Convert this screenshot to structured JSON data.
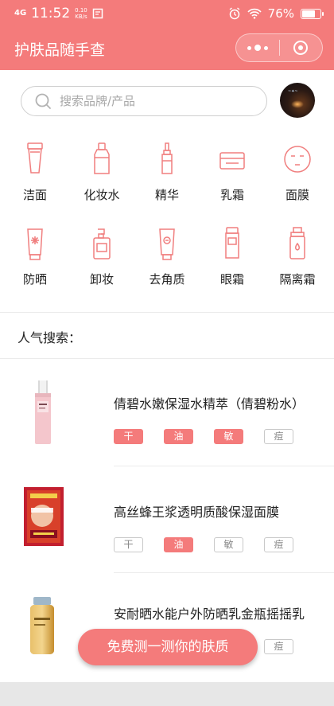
{
  "status_bar": {
    "signal": "4G",
    "time": "11:52",
    "speed_value": "0.10",
    "speed_unit": "KB/s",
    "battery": "76%",
    "battery_level": 0.76
  },
  "nav": {
    "title": "护肤品随手查"
  },
  "search": {
    "placeholder": "搜索品牌/产品"
  },
  "categories": [
    {
      "label": "洁面",
      "icon": "cleanser-tube-icon"
    },
    {
      "label": "化妆水",
      "icon": "toner-bottle-icon"
    },
    {
      "label": "精华",
      "icon": "serum-dropper-icon"
    },
    {
      "label": "乳霜",
      "icon": "cream-jar-icon"
    },
    {
      "label": "面膜",
      "icon": "face-mask-icon"
    },
    {
      "label": "防晒",
      "icon": "sunscreen-icon"
    },
    {
      "label": "卸妆",
      "icon": "pump-bottle-icon"
    },
    {
      "label": "去角质",
      "icon": "exfoliator-tube-icon"
    },
    {
      "label": "眼霜",
      "icon": "eye-cream-icon"
    },
    {
      "label": "隔离霜",
      "icon": "primer-bottle-icon"
    }
  ],
  "popular": {
    "title": "人气搜索："
  },
  "skin_tags": [
    "干",
    "油",
    "敏",
    "痘"
  ],
  "products": [
    {
      "name": "倩碧水嫩保湿水精萃（倩碧粉水）",
      "tags_on": [
        true,
        true,
        true,
        false
      ]
    },
    {
      "name": "高丝蜂王浆透明质酸保湿面膜",
      "tags_on": [
        false,
        true,
        false,
        false
      ]
    },
    {
      "name": "安耐晒水能户外防晒乳金瓶摇摇乳",
      "tags_on": [
        false,
        false,
        false,
        false
      ]
    }
  ],
  "cta": {
    "label": "免费测一测你的肤质"
  },
  "colors": {
    "accent": "#f47b7b",
    "icon_stroke": "#f07f7f",
    "tag_off": "#c9c9c9"
  }
}
